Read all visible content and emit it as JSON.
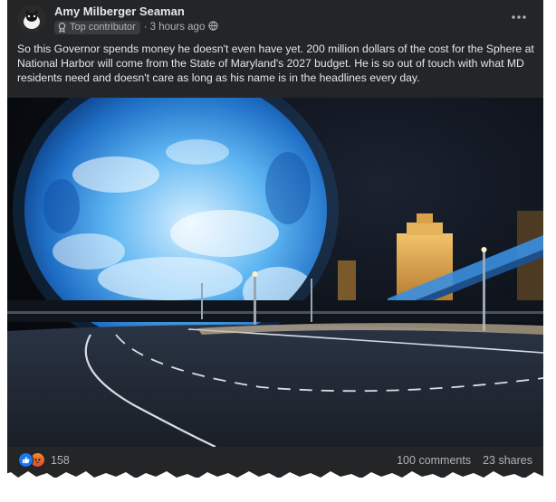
{
  "post": {
    "author": "Amy Milberger Seaman",
    "badge": "Top contributor",
    "separator": "·",
    "time": "3 hours ago",
    "privacy_icon": "globe-icon",
    "more_icon": "more-options-icon",
    "text": "So this Governor spends money he doesn't even have yet. 200 million dollars of the cost for the Sphere at National Harbor will come from the State of Maryland's 2027 budget. He is so out of touch with what MD residents need and doesn't care as long as his name is in the headlines every day."
  },
  "photo": {
    "subject": "night-photo-sphere-venue"
  },
  "footer": {
    "reaction_icons": [
      "like-icon",
      "angry-icon"
    ],
    "reaction_count": "158",
    "comments": "100 comments",
    "shares": "23 shares"
  },
  "colors": {
    "card": "#242526",
    "text_primary": "#e4e6eb",
    "text_secondary": "#b0b3b8",
    "like_blue": "#1877f2"
  }
}
